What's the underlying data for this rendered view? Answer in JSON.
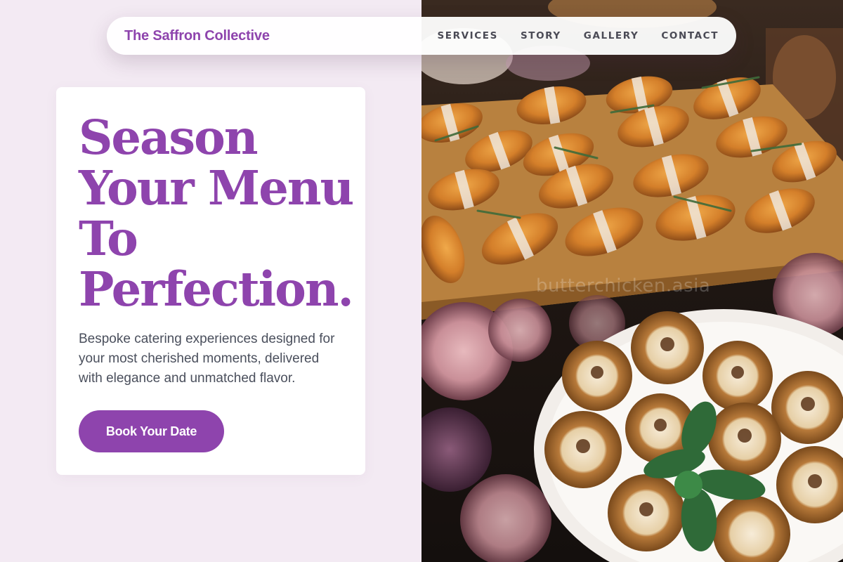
{
  "nav": {
    "brand": "The Saffron Collective",
    "links": [
      "SERVICES",
      "STORY",
      "GALLERY",
      "CONTACT"
    ]
  },
  "hero": {
    "headline": [
      "Season",
      "Your Menu",
      "To",
      "Perfection."
    ],
    "subtitle": "Bespoke catering experiences designed for your most cherished moments, delivered with elegance and unmatched flavor.",
    "cta_label": "Book Your Date"
  },
  "image": {
    "watermark": "butterchicken.asia",
    "subject": "catering-spread-croissants-and-tarts"
  },
  "colors": {
    "accent": "#8e44ad",
    "page_bg": "#f3eaf3",
    "body_text": "#4a4f5c",
    "nav_text": "#4a4a55"
  }
}
